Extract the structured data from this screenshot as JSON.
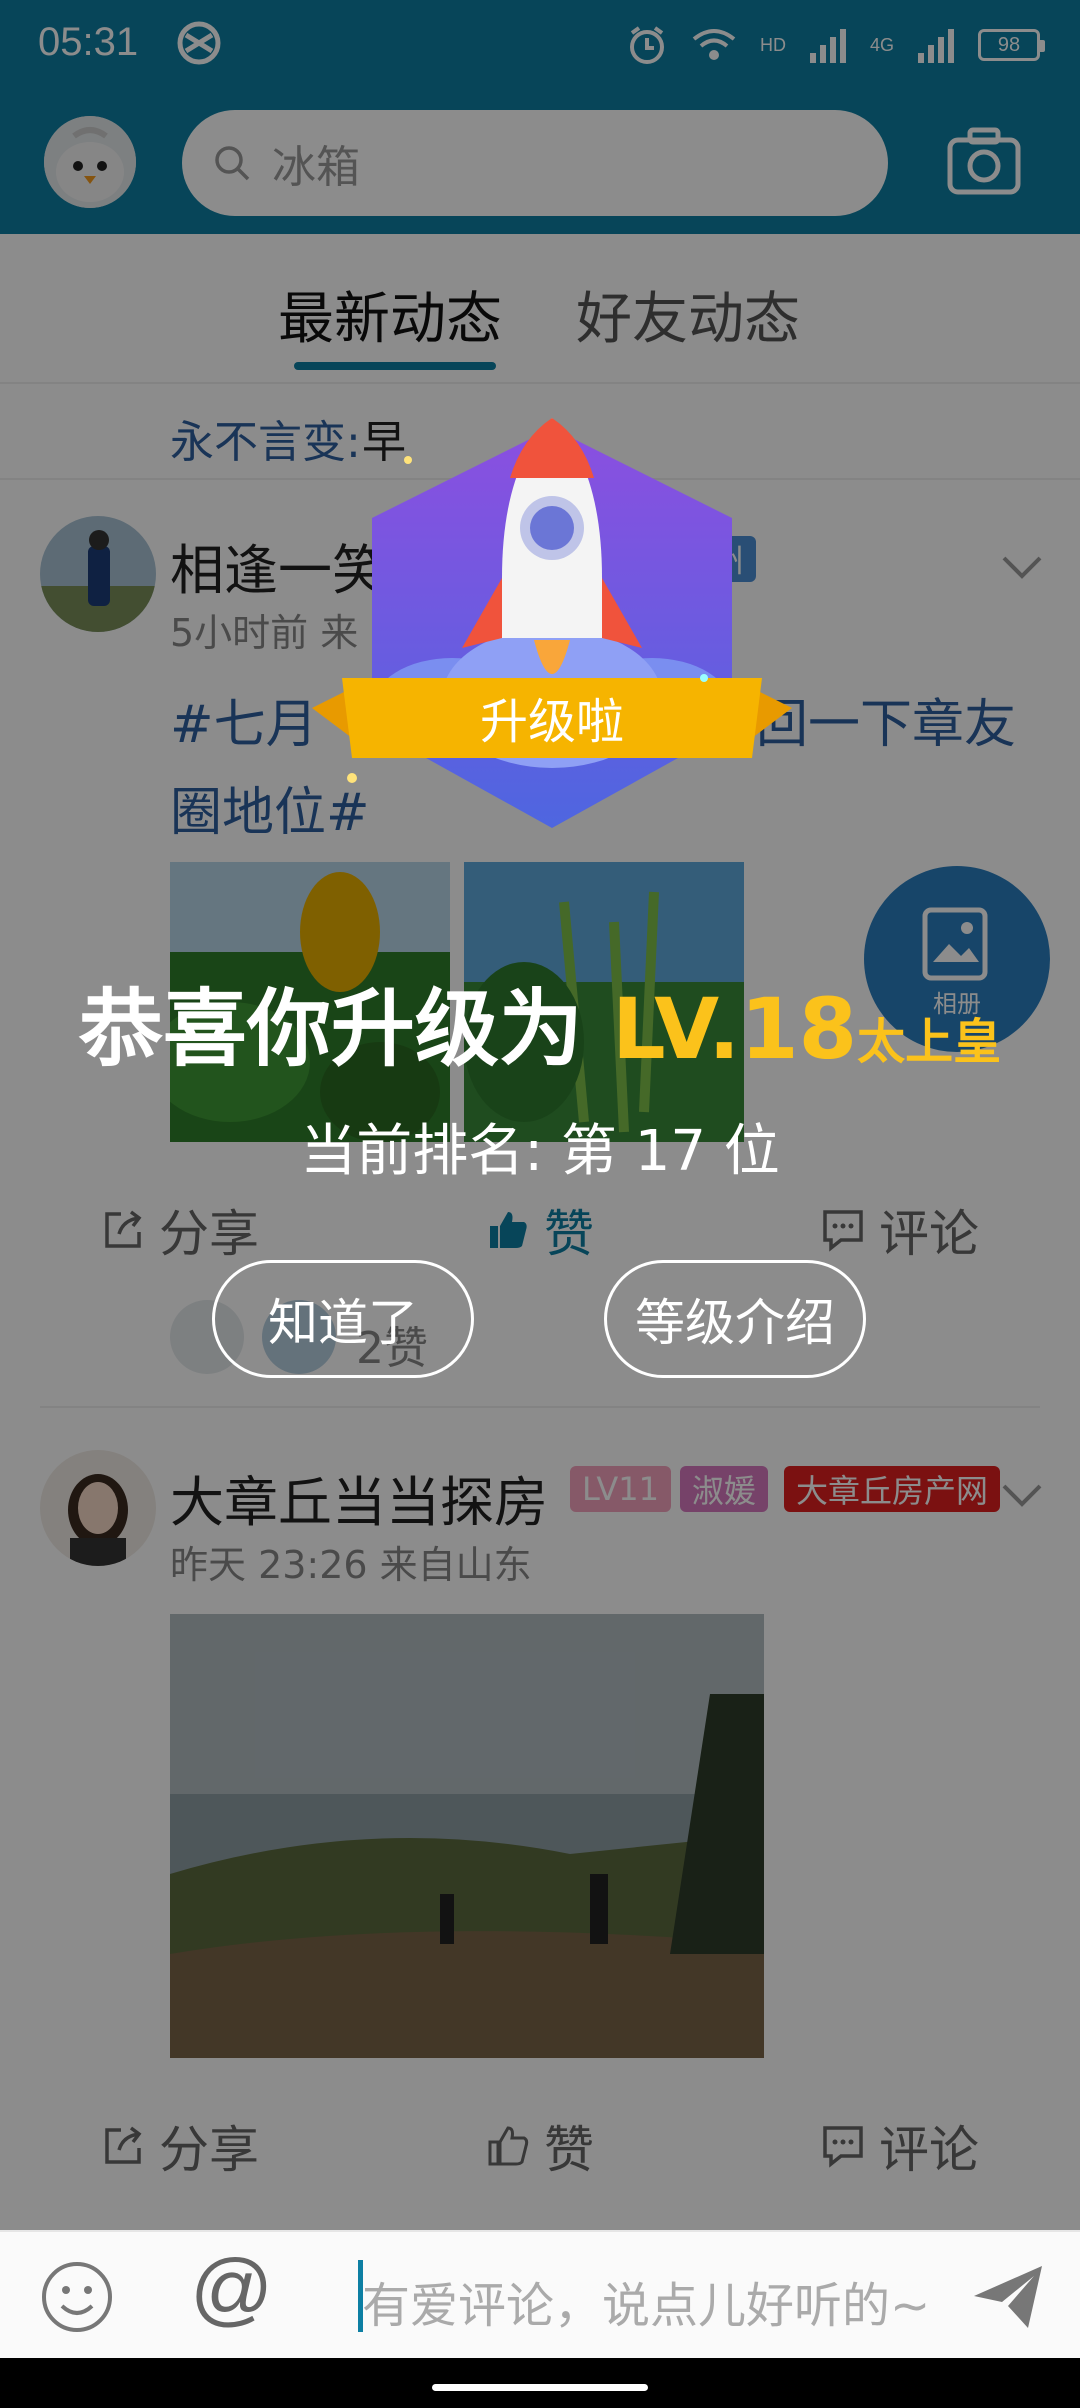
{
  "status_bar": {
    "time": "05:31",
    "battery": "98",
    "network_labels": [
      "HD",
      "4G"
    ]
  },
  "top_bar": {
    "search_placeholder": "冰箱"
  },
  "tabs": [
    {
      "label": "最新动态",
      "active": true
    },
    {
      "label": "好友动态",
      "active": false
    }
  ],
  "notice": {
    "user": "永不言变:",
    "message": "早"
  },
  "posts": [
    {
      "name": "相逢一笑",
      "meta": "5小时前 来",
      "badge_partial": "州",
      "text_line1": "#七月",
      "text_line2": "圈地位#",
      "text_tail": "回一下章友",
      "actions": {
        "share": "分享",
        "like": "赞",
        "comment": "评论"
      },
      "likes": "2赞"
    },
    {
      "name": "大章丘当当探房",
      "meta": "昨天 23:26 来自山东",
      "badges": [
        "LV11",
        "淑媛",
        "大章丘房产网"
      ],
      "actions": {
        "share": "分享",
        "like": "赞",
        "comment": "评论"
      }
    }
  ],
  "floating_button": {
    "label": "相册"
  },
  "comment_bar": {
    "placeholder": "有爱评论，说点儿好听的~"
  },
  "level_up": {
    "ribbon": "升级啦",
    "congrats_prefix": "恭喜你升级为 ",
    "level": "LV.18",
    "level_title": "太上皇",
    "rank_text": "当前排名: 第 17 位",
    "ok_button": "知道了",
    "intro_button": "等级介绍"
  },
  "colors": {
    "brand": "#0d7fa3",
    "gold": "#fbc21b",
    "badge_purple": "#8a5cf6",
    "ribbon": "#f6b400"
  }
}
